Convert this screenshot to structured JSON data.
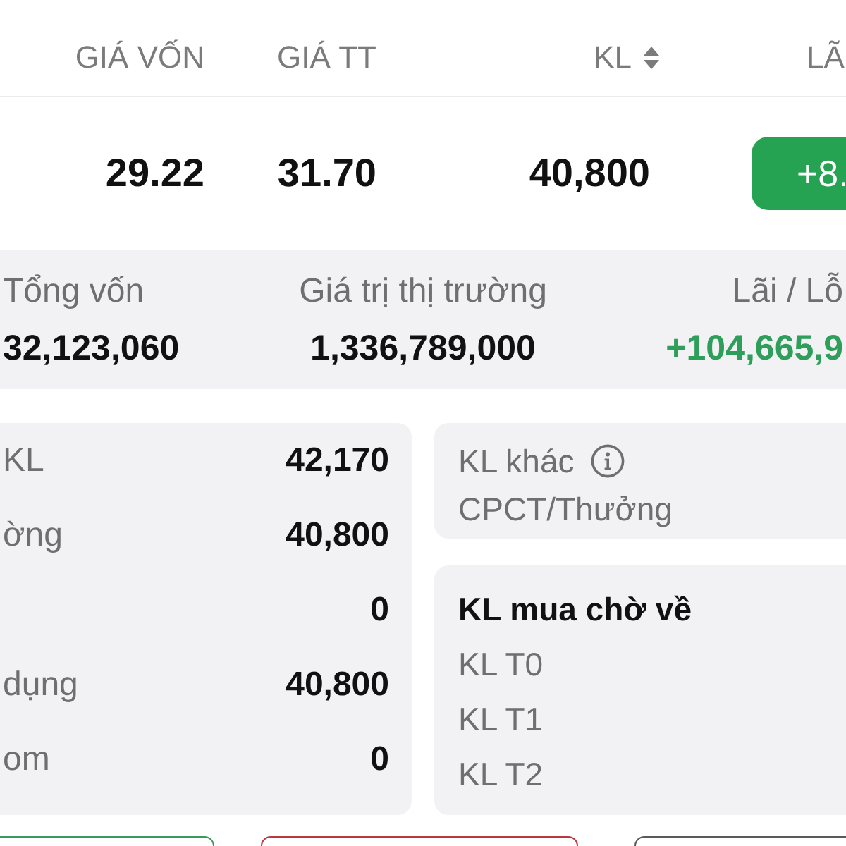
{
  "table_header": {
    "columns": [
      {
        "label": "GIÁ VỐN",
        "sortable": false
      },
      {
        "label": "GIÁ TT",
        "sortable": false
      },
      {
        "label": "KL",
        "sortable": true
      },
      {
        "label": "LÃ",
        "sortable": false
      }
    ]
  },
  "position_row": {
    "cells": [
      "29.22",
      "31.70",
      "40,800"
    ],
    "profit_badge": "+8."
  },
  "summary": [
    {
      "label": "Tổng vốn",
      "value": "32,123,060",
      "kind": "plain"
    },
    {
      "label": "Giá trị thị trường",
      "value": "1,336,789,000",
      "kind": "plain"
    },
    {
      "label": "Lãi / Lỗ",
      "value": "+104,665,9",
      "kind": "gain"
    }
  ],
  "holdings": [
    {
      "label": "KL",
      "value": "42,170"
    },
    {
      "label": "ờng",
      "value": "40,800"
    },
    {
      "value": "0"
    },
    {
      "label": "dụng",
      "value": "40,800"
    },
    {
      "label": "om",
      "value": "0"
    }
  ],
  "other_volume": {
    "title": "KL khác",
    "lines": [
      "CPCT/Thưởng"
    ]
  },
  "pending_buy": {
    "title": "KL mua chờ về",
    "lines": [
      "KL T0",
      "KL T1",
      "KL T2"
    ]
  },
  "bottom_buttons": [
    {
      "color": "#3a9a5c"
    },
    {
      "color": "#b8363e"
    },
    {
      "color": "#5a5a5a"
    }
  ]
}
